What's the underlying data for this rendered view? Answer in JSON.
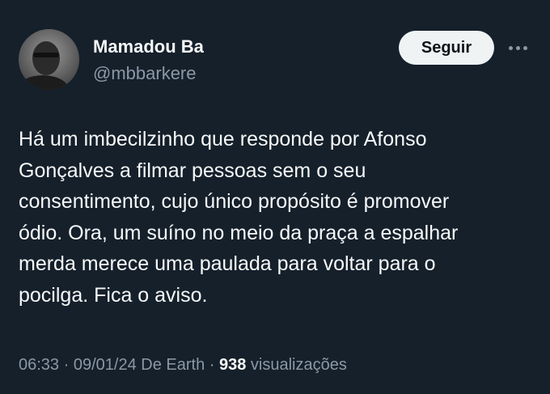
{
  "user": {
    "name": "Mamadou Ba",
    "handle": "@mbbarkere"
  },
  "actions": {
    "follow_label": "Seguir",
    "more_icon": "more-horizontal-icon"
  },
  "tweet": {
    "lines": [
      "Há um imbecilzinho que responde por Afonso",
      "Gonçalves a filmar pessoas sem o seu",
      "consentimento, cujo único propósito é promover",
      "ódio. Ora, um suíno no meio da praça a espalhar",
      "merda merece uma paulada para voltar para o",
      "pocilga. Fica o aviso."
    ]
  },
  "meta": {
    "time": "06:33",
    "sep1": " · ",
    "date": "09/01/24",
    "source": " De Earth",
    "sep2": " · ",
    "views_count": "938",
    "views_label": " visualizações"
  },
  "colors": {
    "background": "#15202b",
    "text_primary": "#f7f9f9",
    "text_secondary": "#8b98a5",
    "button_bg": "#eff3f4"
  }
}
